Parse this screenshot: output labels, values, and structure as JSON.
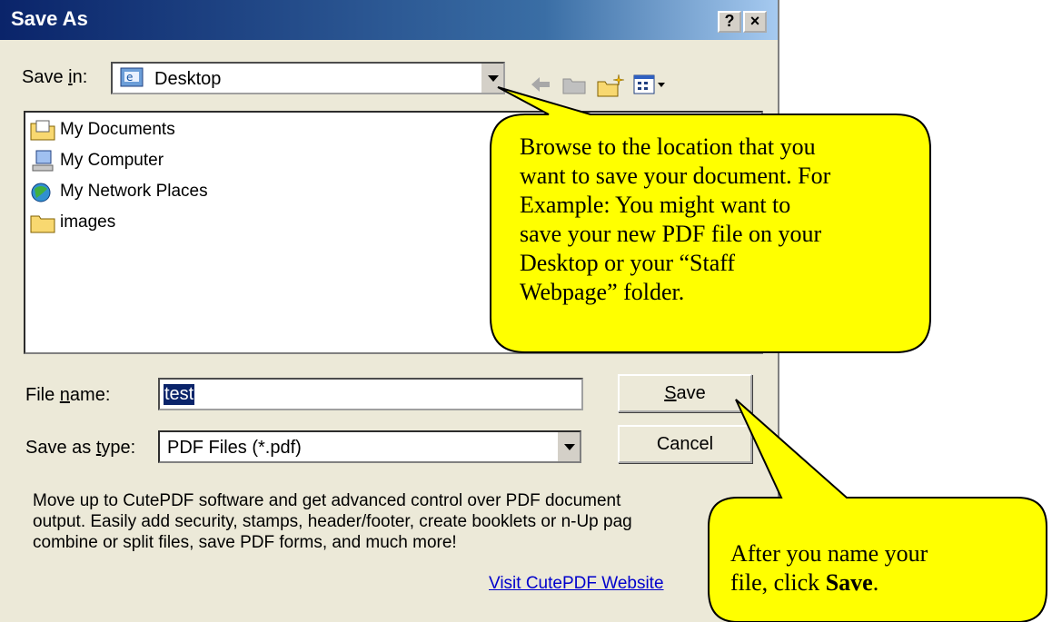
{
  "dialog": {
    "title": "Save As",
    "help_button": "?",
    "close_button": "×",
    "save_in": {
      "label_prefix": "Save ",
      "label_accel": "i",
      "label_suffix": "n:",
      "value": "Desktop"
    },
    "files": [
      {
        "name": "My Documents",
        "icon": "my-documents-icon"
      },
      {
        "name": "My Computer",
        "icon": "my-computer-icon"
      },
      {
        "name": "My Network Places",
        "icon": "network-places-icon"
      },
      {
        "name": "images",
        "icon": "folder-icon"
      }
    ],
    "file_name": {
      "label_prefix": "File ",
      "label_accel": "n",
      "label_suffix": "ame:",
      "value": "test"
    },
    "save_as_type": {
      "label_prefix": "Save as ",
      "label_accel": "t",
      "label_suffix": "ype:",
      "value": "PDF Files (*.pdf)"
    },
    "save_button": {
      "accel": "S",
      "rest": "ave"
    },
    "cancel_button": "Cancel",
    "promo_lines": [
      "Move up to CutePDF software and get advanced control over PDF document",
      "output. Easily add security, stamps, header/footer, create booklets or n-Up pag",
      "combine or split files, save PDF forms, and much more!"
    ],
    "website_link": "Visit CutePDF Website"
  },
  "callouts": {
    "browse_lines": [
      "Browse to the location that you",
      "want to save your document. For",
      "Example: You might want to",
      "save your new PDF file on your",
      "Desktop or your “Staff",
      "Webpage” folder."
    ],
    "save_line1": "After you name your",
    "save_line2_prefix": "file, click ",
    "save_line2_bold": "Save",
    "save_line2_suffix": "."
  },
  "colors": {
    "callout_fill": "#ffff00",
    "titlebar": "#0a246a",
    "dialog_bg": "#ece9d8"
  }
}
